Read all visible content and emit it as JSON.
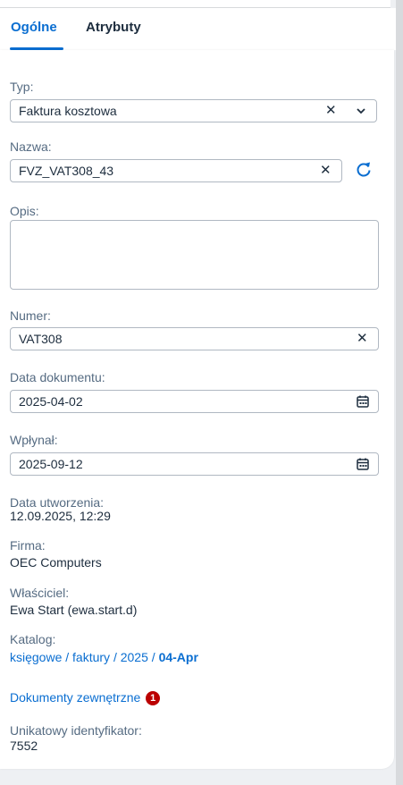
{
  "tabs": [
    {
      "label": "Ogólne",
      "active": true
    },
    {
      "label": "Atrybuty",
      "active": false
    }
  ],
  "form": {
    "type": {
      "label": "Typ:",
      "value": "Faktura kosztowa"
    },
    "name": {
      "label": "Nazwa:",
      "value": "FVZ_VAT308_43"
    },
    "description": {
      "label": "Opis:",
      "value": ""
    },
    "number": {
      "label": "Numer:",
      "value": "VAT308"
    },
    "doc_date": {
      "label": "Data dokumentu:",
      "value": "2025-04-02"
    },
    "received": {
      "label": "Wpłynał:",
      "value": "2025-09-12"
    }
  },
  "info": {
    "created_label": "Data utworzenia:",
    "created_value": "12.09.2025, 12:29",
    "company_label": "Firma:",
    "company_value": "OEC Computers",
    "owner_label": "Właściciel:",
    "owner_value": "Ewa Start (ewa.start.d)",
    "catalog_label": "Katalog:",
    "catalog_path": [
      "księgowe",
      "faktury",
      "2025",
      "04-Apr"
    ],
    "catalog_sep": " / ",
    "external_docs_label": "Dokumenty zewnętrzne",
    "external_docs_count": "1",
    "uid_label": "Unikatowy identyfikator:",
    "uid_value": "7552"
  },
  "icons": {
    "clear": "✕",
    "dropdown": "chevron-down-icon",
    "refresh": "refresh-icon",
    "calendar": "calendar-icon"
  },
  "colors": {
    "accent": "#0a6ed1",
    "badge": "#bb0000"
  }
}
